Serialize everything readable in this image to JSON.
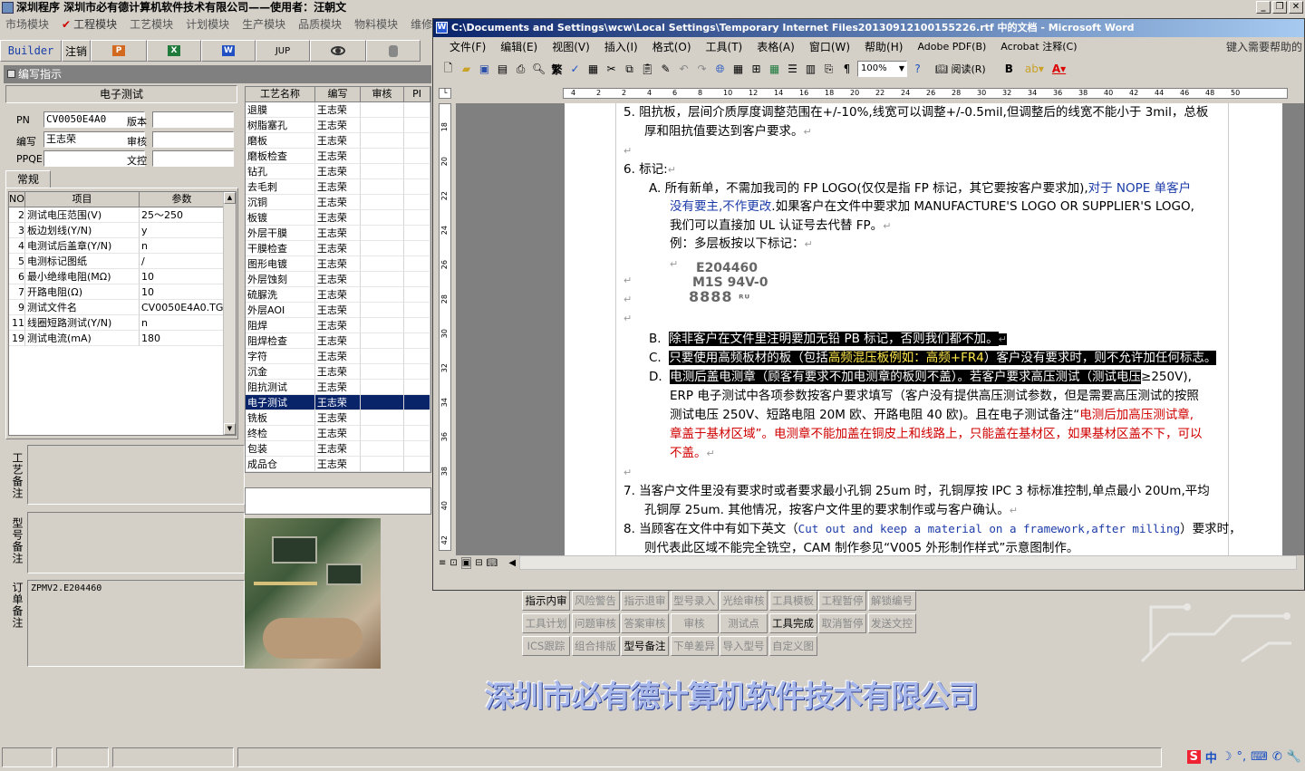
{
  "app": {
    "title": "深圳程序  深圳市必有德计算机软件技术有限公司——使用者：汪朝文",
    "menu": [
      "市场模块",
      "工程模块",
      "工艺模块",
      "计划模块",
      "生产模块",
      "品质模块",
      "物料模块",
      "维修"
    ],
    "menu_checked_index": 1,
    "toolbar": [
      "Builder",
      "注销",
      "P",
      "X",
      "W",
      "JUP",
      "eye",
      "db"
    ],
    "panel_title": "编写指示"
  },
  "form": {
    "title": "电子测试",
    "pn_label": "PN",
    "pn_value": "CV0050E4A0",
    "writer_label": "编写",
    "writer_value": "王志荣",
    "ppqe_label": "PPQE",
    "ppqe_value": "",
    "version_label": "版本",
    "version_value": "",
    "review_label": "审核",
    "review_value": "",
    "control_label": "文控",
    "control_value": "",
    "tab": "常规"
  },
  "params": {
    "headers": [
      "NO",
      "项目",
      "参数"
    ],
    "rows": [
      [
        "2",
        "测试电压范围(V)",
        "25～250"
      ],
      [
        "3",
        "板边划线(Y/N)",
        "y"
      ],
      [
        "4",
        "电测试后盖章(Y/N)",
        "n"
      ],
      [
        "5",
        "电测标记图纸",
        "/"
      ],
      [
        "6",
        "最小绝缘电阻(MΩ)",
        "10"
      ],
      [
        "7",
        "开路电阻(Ω)",
        "10"
      ],
      [
        "9",
        "测试文件名",
        "CV0050E4A0.TGZ"
      ],
      [
        "11",
        "线圈短路测试(Y/N)",
        "n"
      ],
      [
        "19",
        "测试电流(mA)",
        "180"
      ]
    ]
  },
  "notes": {
    "process_note_label": "工艺备注",
    "model_note_label": "型号备注",
    "order_note_label": "订单备注",
    "order_note_value": "ZPMV2.E204460"
  },
  "process": {
    "headers": [
      "工艺名称",
      "编写",
      "审核",
      "PI"
    ],
    "rows": [
      [
        "退膜",
        "王志荣"
      ],
      [
        "树脂塞孔",
        "王志荣"
      ],
      [
        "磨板",
        "王志荣"
      ],
      [
        "磨板检查",
        "王志荣"
      ],
      [
        "钻孔",
        "王志荣"
      ],
      [
        "去毛刺",
        "王志荣"
      ],
      [
        "沉铜",
        "王志荣"
      ],
      [
        "板镀",
        "王志荣"
      ],
      [
        "外层干膜",
        "王志荣"
      ],
      [
        "干膜检查",
        "王志荣"
      ],
      [
        "图形电镀",
        "王志荣"
      ],
      [
        "外层蚀刻",
        "王志荣"
      ],
      [
        "硫脲洗",
        "王志荣"
      ],
      [
        "外层AOI",
        "王志荣"
      ],
      [
        "阻焊",
        "王志荣"
      ],
      [
        "阻焊检查",
        "王志荣"
      ],
      [
        "字符",
        "王志荣"
      ],
      [
        "沉金",
        "王志荣"
      ],
      [
        "阻抗测试",
        "王志荣"
      ],
      [
        "电子测试",
        "王志荣"
      ],
      [
        "铣板",
        "王志荣"
      ],
      [
        "终检",
        "王志荣"
      ],
      [
        "包装",
        "王志荣"
      ],
      [
        "成品仓",
        "王志荣"
      ]
    ],
    "selected_index": 19
  },
  "word": {
    "title": "C:\\Documents and Settings\\wcw\\Local Settings\\Temporary Internet Files20130912100155226.rtf 中的文档 - Microsoft Word",
    "menu": [
      "文件(F)",
      "编辑(E)",
      "视图(V)",
      "插入(I)",
      "格式(O)",
      "工具(T)",
      "表格(A)",
      "窗口(W)",
      "帮助(H)",
      "Adobe PDF(B)",
      "Acrobat 注释(C)"
    ],
    "help_box": "键入需要帮助的",
    "zoom": "100%",
    "read_label": "阅读(R)",
    "ruler_ticks": [
      "4",
      "2",
      "2",
      "4",
      "6",
      "8",
      "10",
      "12",
      "14",
      "16",
      "18",
      "20",
      "22",
      "24",
      "26",
      "28",
      "30",
      "32",
      "34",
      "36",
      "38",
      "40",
      "42",
      "44",
      "46",
      "48",
      "50"
    ],
    "vruler_ticks": [
      "18",
      "20",
      "22",
      "24",
      "26",
      "28",
      "30",
      "32",
      "34",
      "36",
      "38",
      "40",
      "42"
    ],
    "lines": {
      "l1": "5.  阻抗板，层间介质厚度调整范围在+/-10%,线宽可以调整+/-0.5mil,但调整后的线宽不能小于  3mil，总板",
      "l2": "厚和阻抗值要达到客户要求。",
      "l3": "6.  标记:",
      "l4a": "A.  所有新单，不需加我司的 FP LOGO(仅仅是指 FP 标记，其它要按客户要求加),",
      "l4b": "对于 NOPE 单客户",
      "l5a": "没有要主,不作更改",
      "l5b": ".如果客户在文件中要求加 MANUFACTURE'S LOGO OR SUPPLIER'S LOGO,",
      "l6": "我们可以直接加 UL 认证号去代替 FP。",
      "l7": "例：多层板按以下标记：",
      "mark1": "E204460",
      "mark2": "M1S 94V-0",
      "mark3": "8888",
      "lB": "B.",
      "lBtext": "除非客户在文件里注明要加无铅 PB 标记，否则我们都不加。",
      "lC": "C.",
      "lCtext1": "只要使用高频板材的板（包括",
      "lCtext2": "高频混压板例如：高频+FR4",
      "lCtext3": "）客户没有要求时，则不允许加任何标志。",
      "lD": "D.",
      "lDtext1": "电测后盖电测章（顾客有要求不加电测章的板则不盖）。若客户要求高压测试（测试电压",
      "lDtext2": "≥250V),",
      "l9": "ERP 电子测试中各项参数按客户要求填写（客户没有提供高压测试参数，但是需要高压测试的按照",
      "l10a": "测试电压 250V、短路电阻 20M 欧、开路电阻 40 欧)。且在电子测试备注“",
      "l10b": "电测后加高压测试章,",
      "l11a": "章盖于基材区域”",
      "l11b": "。电测章不能加盖在铜皮上和线路上，只能盖在基材区，如果基材区盖不下，可以",
      "l12": "不盖。",
      "l13": "7.  当客户文件里没有要求时或者要求最小孔铜 25um 时，孔铜厚按 IPC 3 标标准控制,单点最小 20Um,平均",
      "l14": "孔铜厚 25um. 其他情况，按客户文件里的要求制作或与客户确认。",
      "l15a": "8.  当顾客在文件中有如下英文（",
      "l15b": "Cut out and keep a material on a framework,after milling",
      "l15c": "）要求时，",
      "l16": "则代表此区域不能完全铣空，CAM 制作参见“V005 外形制作样式”示意图制作。"
    }
  },
  "buttons": [
    [
      "指示内审",
      true
    ],
    [
      "风险警告",
      false
    ],
    [
      "指示退审",
      false
    ],
    [
      "型号录入",
      false
    ],
    [
      "光绘审核",
      false
    ],
    [
      "工具模板",
      false
    ],
    [
      "工程暂停",
      false
    ],
    [
      "解锁编号",
      false
    ],
    [
      "工具计划",
      false
    ],
    [
      "问题审核",
      false
    ],
    [
      "答案审核",
      false
    ],
    [
      "审核Nope",
      false
    ],
    [
      "测试点",
      false
    ],
    [
      "工具完成",
      true
    ],
    [
      "取消暂停",
      false
    ],
    [
      "发送文控",
      false
    ],
    [
      "ICS跟踪",
      false
    ],
    [
      "组合排版",
      false
    ],
    [
      "型号备注",
      true
    ],
    [
      "下单差异",
      false
    ],
    [
      "导入型号",
      false
    ],
    [
      "自定义图",
      false
    ]
  ],
  "logo_text": "深圳市必有德计算机软件技术有限公司",
  "tray": [
    "S",
    "中",
    "☽",
    "°,",
    "⌨",
    "✆",
    "🔧"
  ]
}
